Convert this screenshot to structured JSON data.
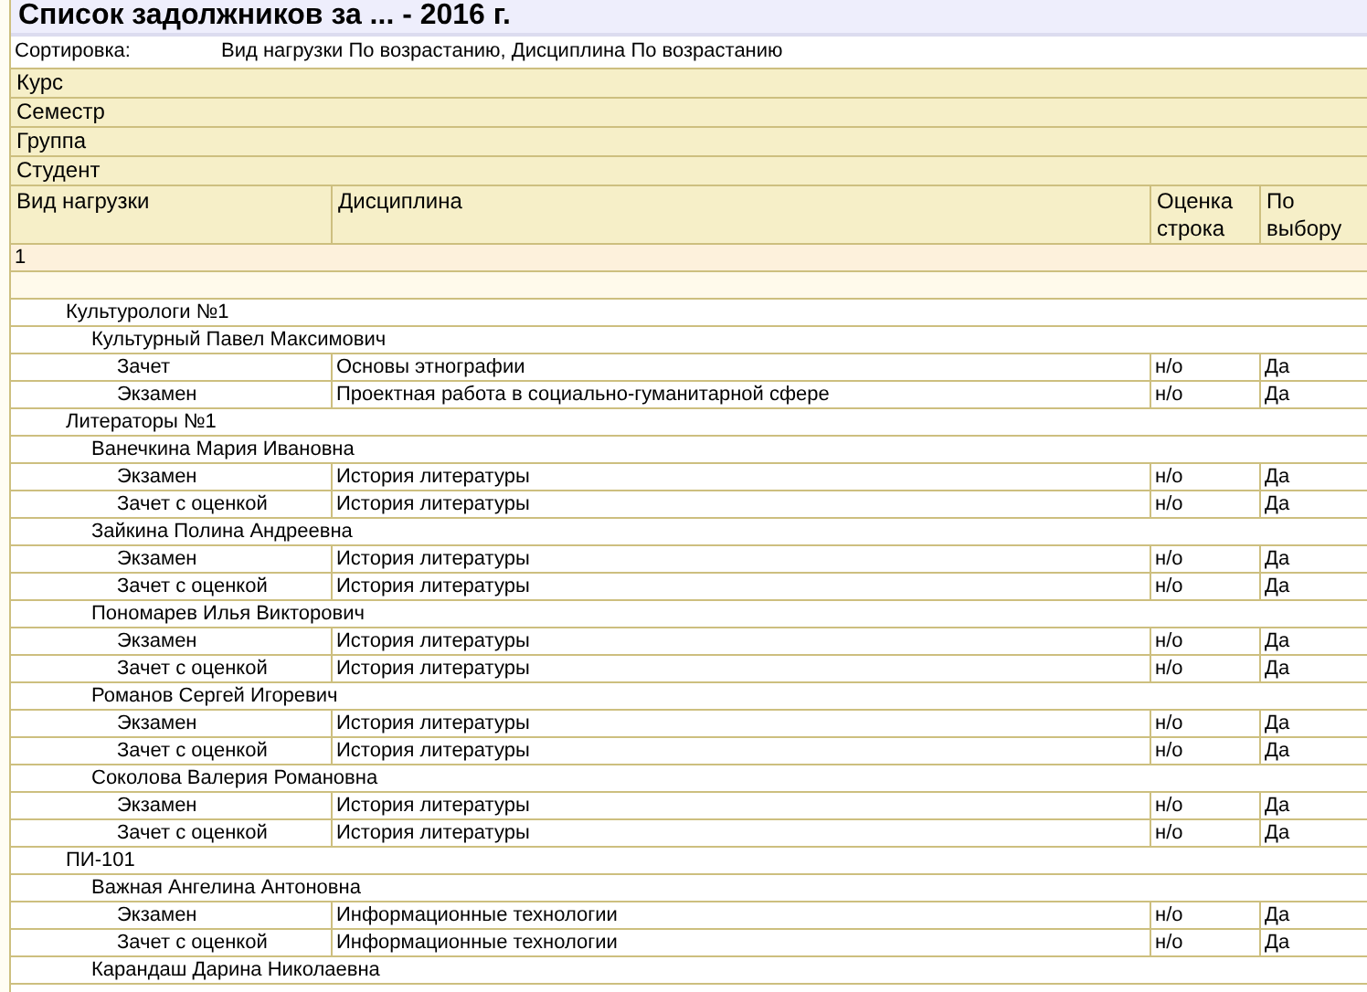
{
  "title": "Список задолжников за ... - 2016 г.",
  "sorting": {
    "label": "Сортировка:",
    "value": "Вид нагрузки По возрастанию, Дисциплина По возрастанию"
  },
  "grouping_headers": [
    "Курс",
    "Семестр",
    "Группа",
    "Студент"
  ],
  "columns": [
    "Вид нагрузки",
    "Дисциплина",
    "Оценка строка",
    "По выбору"
  ],
  "course": "1",
  "groups": [
    {
      "name": "Культурологи №1",
      "children": [
        {
          "name": "Культурный Павел Максимович",
          "children": [
            {
              "type": "Зачет",
              "discipline": "Основы этнографии",
              "grade": "н/о",
              "elective": "Да"
            },
            {
              "type": "Экзамен",
              "discipline": "Проектная работа в социально-гуманитарной сфере",
              "grade": "н/о",
              "elective": "Да"
            }
          ]
        }
      ]
    },
    {
      "name": "Литераторы №1",
      "children": [
        {
          "name": "Ванечкина Мария Ивановна",
          "children": [
            {
              "type": "Экзамен",
              "discipline": "История литературы",
              "grade": "н/о",
              "elective": "Да"
            },
            {
              "type": "Зачет с оценкой",
              "discipline": "История литературы",
              "grade": "н/о",
              "elective": "Да"
            }
          ]
        },
        {
          "name": "Зайкина Полина Андреевна",
          "children": [
            {
              "type": "Экзамен",
              "discipline": "История литературы",
              "grade": "н/о",
              "elective": "Да"
            },
            {
              "type": "Зачет с оценкой",
              "discipline": "История литературы",
              "grade": "н/о",
              "elective": "Да"
            }
          ]
        },
        {
          "name": "Пономарев Илья Викторович",
          "children": [
            {
              "type": "Экзамен",
              "discipline": "История литературы",
              "grade": "н/о",
              "elective": "Да"
            },
            {
              "type": "Зачет с оценкой",
              "discipline": "История литературы",
              "grade": "н/о",
              "elective": "Да"
            }
          ]
        },
        {
          "name": "Романов Сергей Игоревич",
          "children": [
            {
              "type": "Экзамен",
              "discipline": "История литературы",
              "grade": "н/о",
              "elective": "Да"
            },
            {
              "type": "Зачет с оценкой",
              "discipline": "История литературы",
              "grade": "н/о",
              "elective": "Да"
            }
          ]
        },
        {
          "name": "Соколова Валерия Романовна",
          "children": [
            {
              "type": "Экзамен",
              "discipline": "История литературы",
              "grade": "н/о",
              "elective": "Да"
            },
            {
              "type": "Зачет с оценкой",
              "discipline": "История литературы",
              "grade": "н/о",
              "elective": "Да"
            }
          ]
        }
      ]
    },
    {
      "name": "ПИ-101",
      "children": [
        {
          "name": "Важная Ангелина Антоновна",
          "children": [
            {
              "type": "Экзамен",
              "discipline": "Информационные технологии",
              "grade": "н/о",
              "elective": "Да"
            },
            {
              "type": "Зачет с оценкой",
              "discipline": "Информационные технологии",
              "grade": "н/о",
              "elective": "Да"
            }
          ]
        },
        {
          "name": "Карандаш Дарина Николаевна"
        }
      ]
    }
  ]
}
